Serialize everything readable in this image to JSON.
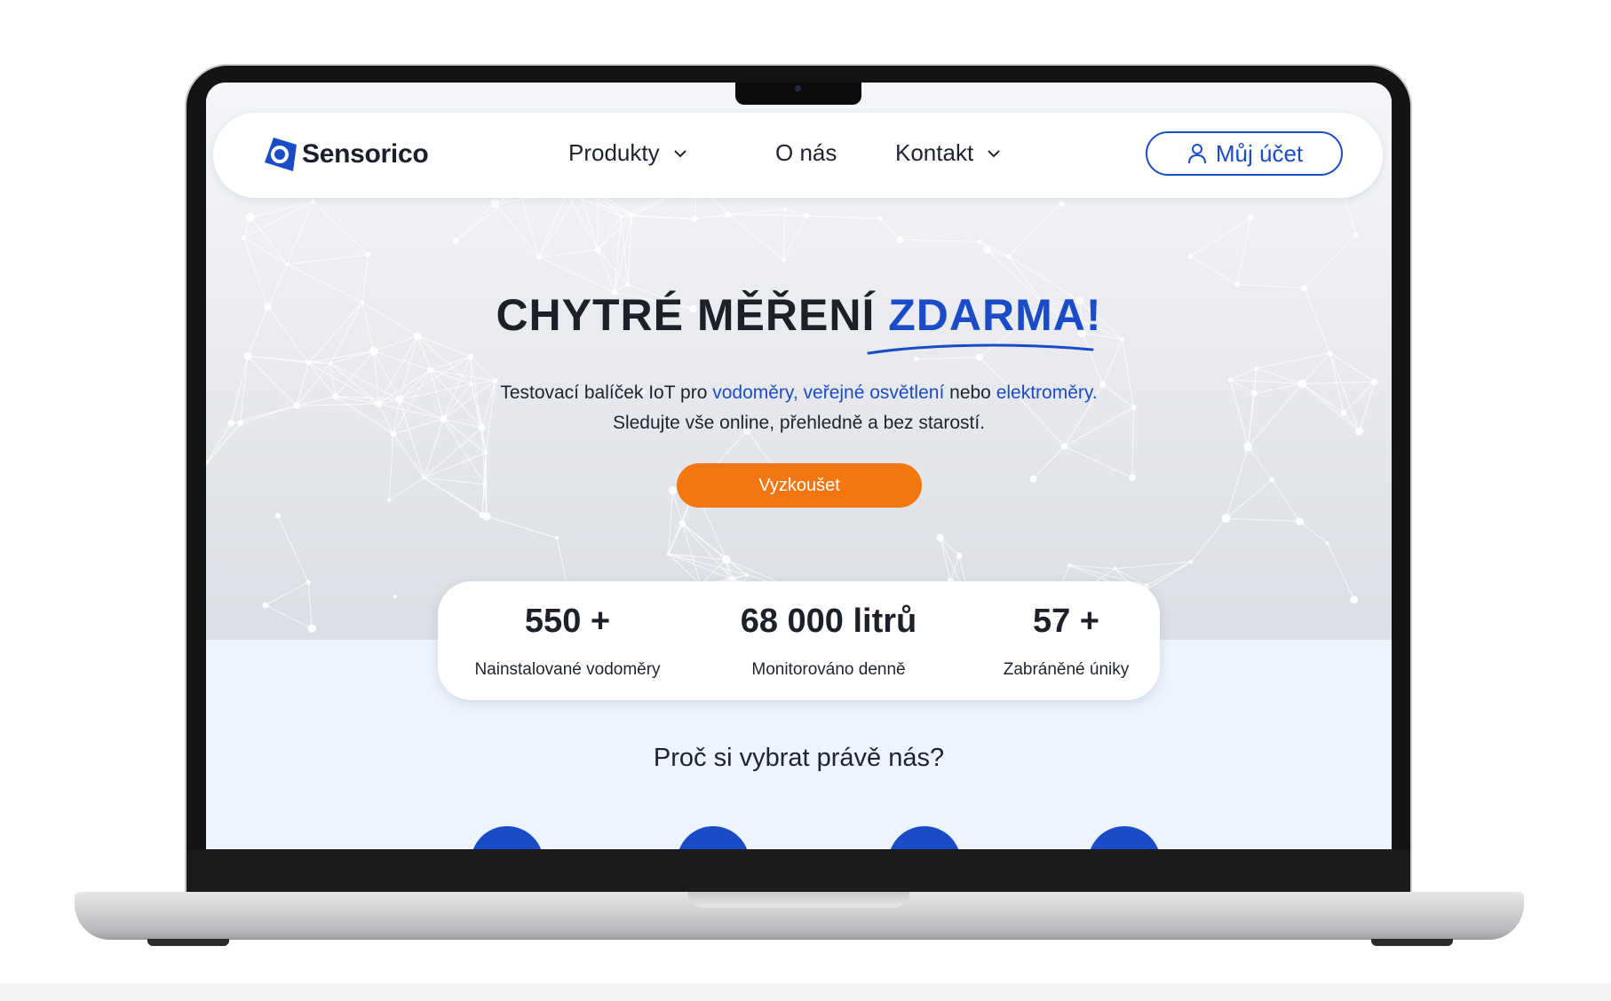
{
  "brand": {
    "name": "Sensorico",
    "accent_color": "#1a4cc7",
    "cta_color": "#f4760f"
  },
  "nav": {
    "items": [
      {
        "label": "Produkty",
        "has_dropdown": true
      },
      {
        "label": "O nás",
        "has_dropdown": false
      },
      {
        "label": "Kontakt",
        "has_dropdown": true
      }
    ],
    "account_label": "Můj účet",
    "account_icon": "user-icon"
  },
  "hero": {
    "title_main": "CHYTRÉ MĚŘENÍ",
    "title_accent": "ZDARMA!",
    "sub_line1_prefix": "Testovací balíček IoT pro",
    "sub_link1": "vodoměry, veřejné osvětlení",
    "sub_line1_mid": "nebo",
    "sub_link2": "elektroměry.",
    "sub_line2": "Sledujte vše online, přehledně a bez starostí.",
    "cta_label": "Vyzkoušet"
  },
  "stats": [
    {
      "value": "550 +",
      "label": "Nainstalované vodoměry"
    },
    {
      "value": "68 000 litrů",
      "label": "Monitorováno denně"
    },
    {
      "value": "57 +",
      "label": "Zabráněné úniky"
    }
  ],
  "why": {
    "title": "Proč si vybrat právě nás?"
  }
}
